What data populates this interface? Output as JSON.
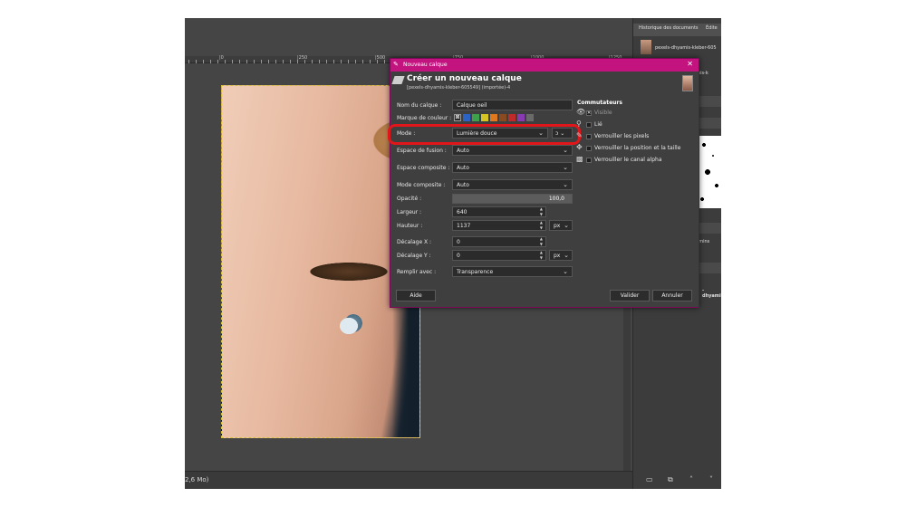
{
  "app": {
    "ruler_labels": [
      "|0",
      "|250",
      "|500",
      "|750",
      "|1000",
      "|1250"
    ],
    "status_text": "2,6 Mo)"
  },
  "dock": {
    "tab_history": "Historique des documents",
    "tab_editor": "Édite",
    "history_item": "pexels-dhyamis-kleber-605",
    "layer_suffix": "hyamis-k",
    "chemins": "hemins",
    "dhyan_label": "-dhyamis"
  },
  "dialog": {
    "window_title": "Nouveau calque",
    "heading": "Créer un nouveau calque",
    "subtitle": "[pexels-dhyamis-kleber-605549] (importée)-4",
    "fields": {
      "name_label": "Nom du calque :",
      "name_value": "Calque oeil",
      "color_tag_label": "Marque de couleur :",
      "mode_label": "Mode :",
      "mode_value": "Lumière douce",
      "blend_space_label": "Espace de fusion :",
      "blend_space_value": "Auto",
      "composite_space_label": "Espace composite :",
      "composite_space_value": "Auto",
      "composite_mode_label": "Mode composite :",
      "composite_mode_value": "Auto",
      "opacity_label": "Opacité :",
      "opacity_value": "100,0",
      "width_label": "Largeur :",
      "width_value": "640",
      "height_label": "Hauteur :",
      "height_value": "1137",
      "unit_value": "px",
      "offset_x_label": "Décalage X :",
      "offset_x_value": "0",
      "offset_y_label": "Décalage Y :",
      "offset_y_value": "0",
      "fill_label": "Remplir avec :",
      "fill_value": "Transparence"
    },
    "switches": {
      "title": "Commutateurs",
      "visible": "Visible",
      "linked": "Lié",
      "lock_pixels": "Verrouiller les pixels",
      "lock_position": "Verrouiller la position et la taille",
      "lock_alpha": "Verrouiller le canal alpha"
    },
    "buttons": {
      "help": "Aide",
      "ok": "Valider",
      "cancel": "Annuler"
    },
    "colors": {
      "title_bar": "#c3137f",
      "highlight": "#e0161b",
      "swatches": [
        "#2a63c4",
        "#3ea04a",
        "#d6c424",
        "#e07820",
        "#8a4a20",
        "#c02a2a",
        "#8a3ab0",
        "#6a6a6a"
      ]
    }
  }
}
